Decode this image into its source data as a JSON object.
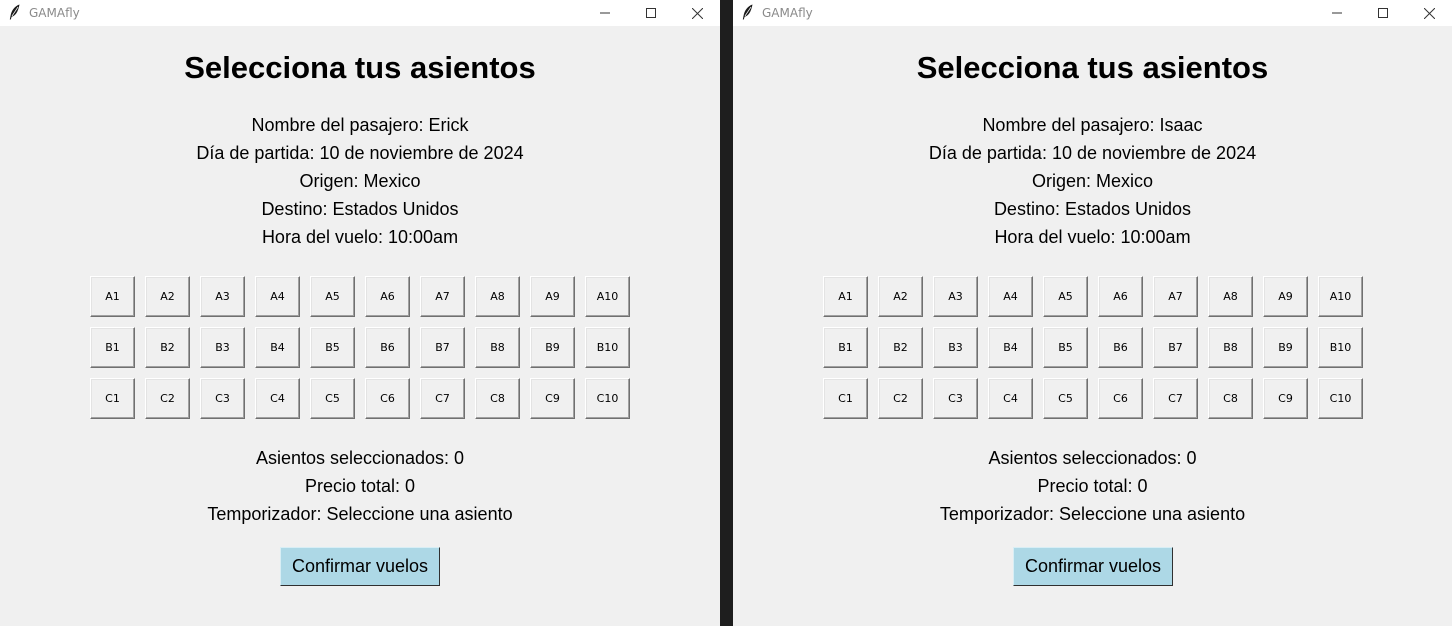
{
  "windows": [
    {
      "app_title": "GAMAfly",
      "heading": "Selecciona tus asientos",
      "info": [
        "Nombre del pasajero: Erick",
        "Día de partida: 10 de noviembre de 2024",
        "Origen: Mexico",
        "Destino: Estados Unidos",
        "Hora del vuelo: 10:00am"
      ],
      "seats": [
        [
          "A1",
          "A2",
          "A3",
          "A4",
          "A5",
          "A6",
          "A7",
          "A8",
          "A9",
          "A10"
        ],
        [
          "B1",
          "B2",
          "B3",
          "B4",
          "B5",
          "B6",
          "B7",
          "B8",
          "B9",
          "B10"
        ],
        [
          "C1",
          "C2",
          "C3",
          "C4",
          "C5",
          "C6",
          "C7",
          "C8",
          "C9",
          "C10"
        ]
      ],
      "selected_seats": "Asientos seleccionados: 0",
      "total_price": "Precio total: 0",
      "timer": "Temporizador: Seleccione una asiento",
      "confirm_label": "Confirmar vuelos"
    },
    {
      "app_title": "GAMAfly",
      "heading": "Selecciona tus asientos",
      "info": [
        "Nombre del pasajero: Isaac",
        "Día de partida: 10 de noviembre de 2024",
        "Origen: Mexico",
        "Destino: Estados Unidos",
        "Hora del vuelo: 10:00am"
      ],
      "seats": [
        [
          "A1",
          "A2",
          "A3",
          "A4",
          "A5",
          "A6",
          "A7",
          "A8",
          "A9",
          "A10"
        ],
        [
          "B1",
          "B2",
          "B3",
          "B4",
          "B5",
          "B6",
          "B7",
          "B8",
          "B9",
          "B10"
        ],
        [
          "C1",
          "C2",
          "C3",
          "C4",
          "C5",
          "C6",
          "C7",
          "C8",
          "C9",
          "C10"
        ]
      ],
      "selected_seats": "Asientos seleccionados: 0",
      "total_price": "Precio total: 0",
      "timer": "Temporizador: Seleccione una asiento",
      "confirm_label": "Confirmar vuelos"
    }
  ],
  "colors": {
    "window_bg": "#f0f0f0",
    "titlebar_bg": "#ffffff",
    "confirm_button_bg": "#add8e6",
    "desktop_divider": "#1e1e1e"
  },
  "icons": {
    "app": "feather-icon",
    "minimize": "minimize-icon",
    "maximize": "maximize-icon",
    "close": "close-icon"
  }
}
